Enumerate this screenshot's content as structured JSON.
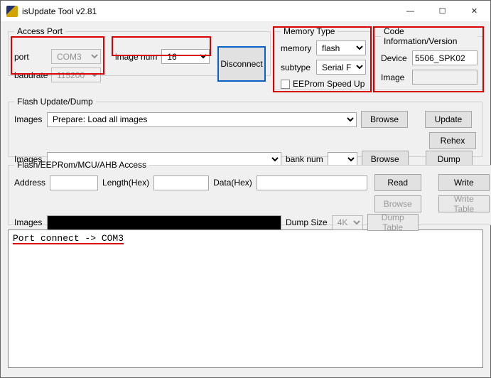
{
  "window": {
    "title": "isUpdate Tool v2.81",
    "min": "―",
    "max": "☐",
    "close": "✕"
  },
  "accessPort": {
    "legend": "Access Port",
    "portLabel": "port",
    "portValue": "COM3",
    "baudLabel": "baudrate",
    "baudValue": "115200",
    "imageNumLabel": "image num",
    "imageNumValue": "16",
    "disconnect": "Disconnect"
  },
  "memoryType": {
    "legend": "Memory Type",
    "memoryLabel": "memory",
    "memoryValue": "flash",
    "subtypeLabel": "subtype",
    "subtypeValue": "Serial Flash",
    "eeprom": "EEProm Speed Up"
  },
  "codeInfo": {
    "legend": "Code Information/Version",
    "deviceLabel": "Device",
    "deviceValue": "5506_SPK02",
    "imageLabel": "Image",
    "imageValue": ""
  },
  "flashUpdate": {
    "legend": "Flash Update/Dump",
    "imagesLabel": "Images",
    "images1Value": "Prepare: Load all images",
    "browse": "Browse",
    "update": "Update",
    "rehex": "Rehex",
    "images2Value": "",
    "bankNumLabel": "bank num",
    "bankNumValue": "",
    "dump": "Dump"
  },
  "flashAccess": {
    "legend": "Flash/EEPRom/MCU/AHB Access",
    "addressLabel": "Address",
    "addressValue": "",
    "lengthLabel": "Length(Hex)",
    "lengthValue": "",
    "dataLabel": "Data(Hex)",
    "dataValue": "",
    "read": "Read",
    "write": "Write",
    "browse": "Browse",
    "writeTable": "Write Table",
    "imagesLabel": "Images",
    "imagesValue": "",
    "dumpSizeLabel": "Dump Size",
    "dumpSizeValue": "4K",
    "dumpTable": "Dump Table"
  },
  "console": {
    "line1": "Port connect -> COM3"
  }
}
